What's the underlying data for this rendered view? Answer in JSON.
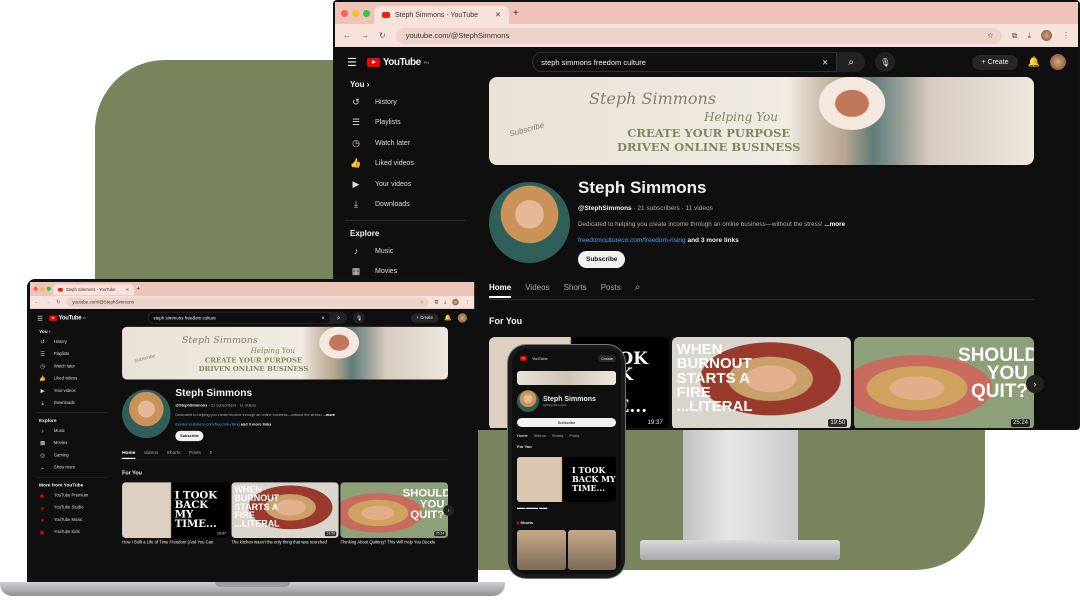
{
  "browser": {
    "tab_title": "Steph Simmons - YouTube",
    "url": "youtube.com/@StephSimmons"
  },
  "header": {
    "logo": "YouTube",
    "region": "PH",
    "search_value": "steph simmons freedom culture",
    "create": "Create"
  },
  "sidebar": {
    "you": "You ›",
    "you_items": [
      {
        "label": "History",
        "icon": "↺"
      },
      {
        "label": "Playlists",
        "icon": "☰"
      },
      {
        "label": "Watch later",
        "icon": "◷"
      },
      {
        "label": "Liked videos",
        "icon": "👍"
      },
      {
        "label": "Your videos",
        "icon": "▶"
      },
      {
        "label": "Downloads",
        "icon": "⤓"
      }
    ],
    "explore": "Explore",
    "explore_items": [
      {
        "label": "Music",
        "icon": "♪"
      },
      {
        "label": "Movies",
        "icon": "▦"
      },
      {
        "label": "Gaming",
        "icon": "◎"
      },
      {
        "label": "Show more",
        "icon": "⌄"
      }
    ],
    "more": "More from YouTube",
    "more_items": [
      {
        "label": "YouTube Premium"
      },
      {
        "label": "YouTube Studio"
      },
      {
        "label": "YouTube Music"
      },
      {
        "label": "YouTube Kids"
      }
    ]
  },
  "banner": {
    "script": "Steph Simmons",
    "tagline": "Helping You",
    "headline1": "CREATE YOUR PURPOSE",
    "headline2": "DRIVEN ONLINE BUSINESS",
    "subscribe_note": "Subscribe"
  },
  "channel": {
    "name": "Steph Simmons",
    "handle": "@StephSimmons",
    "stats": " · 21 subscribers · 11 videos",
    "description": "Dedicated to helping you create income through an online business—without the stress! ",
    "more": "...more",
    "link": "freedomcultureco.com/freedom-rising",
    "more_links": " and 3 more links",
    "subscribe": "Subscribe"
  },
  "tabs": [
    "Home",
    "Videos",
    "Shorts",
    "Posts"
  ],
  "section": "For You",
  "videos": [
    {
      "thumb_text": "I TOOK BACK MY TIME...",
      "duration": "19:37",
      "title": "How I Built a Life of Time Freedom (And You Can"
    },
    {
      "thumb_text": "WHEN BURNOUT STARTS A FIRE ...LITERAL",
      "duration": "19:50",
      "title": "The kitchen wasn't the only thing that was scorched"
    },
    {
      "thumb_text": "SHOULD YOU QUIT?",
      "duration": "25:24",
      "title": "Thinking About Quitting? This Will Help You Decide"
    }
  ],
  "phone": {
    "shorts": "Shorts"
  }
}
